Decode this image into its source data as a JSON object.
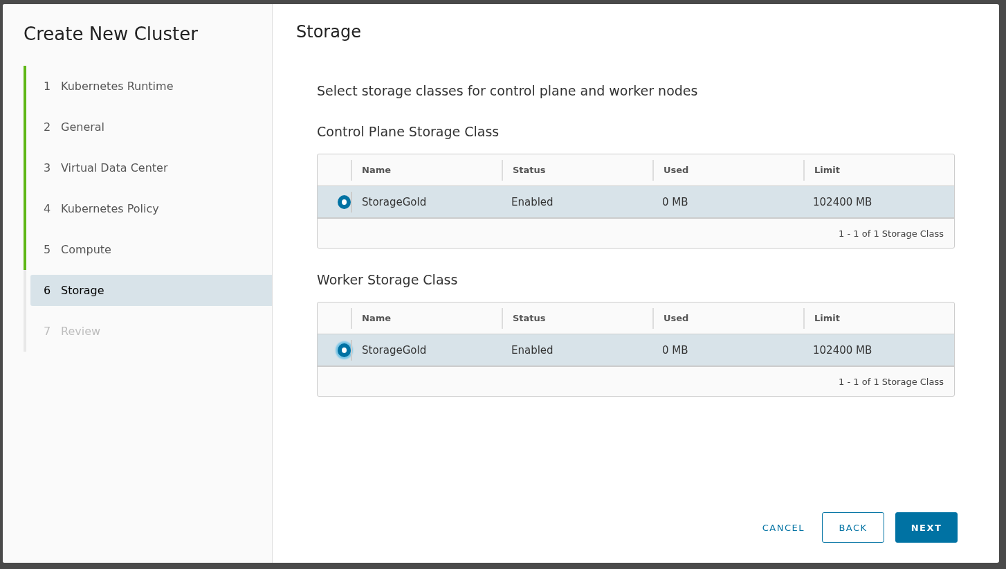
{
  "wizard": {
    "title": "Create New Cluster",
    "steps": [
      {
        "number": "1",
        "label": "Kubernetes Runtime",
        "completed": true,
        "selected": false,
        "disabled": false
      },
      {
        "number": "2",
        "label": "General",
        "completed": true,
        "selected": false,
        "disabled": false
      },
      {
        "number": "3",
        "label": "Virtual Data Center",
        "completed": true,
        "selected": false,
        "disabled": false
      },
      {
        "number": "4",
        "label": "Kubernetes Policy",
        "completed": true,
        "selected": false,
        "disabled": false
      },
      {
        "number": "5",
        "label": "Compute",
        "completed": true,
        "selected": false,
        "disabled": false
      },
      {
        "number": "6",
        "label": "Storage",
        "completed": false,
        "selected": true,
        "disabled": false
      },
      {
        "number": "7",
        "label": "Review",
        "completed": false,
        "selected": false,
        "disabled": true
      }
    ]
  },
  "page": {
    "title": "Storage",
    "description": "Select storage classes for control plane and worker nodes",
    "sections": [
      {
        "heading": "Control Plane Storage Class",
        "table": {
          "columns": [
            "Name",
            "Status",
            "Used",
            "Limit"
          ],
          "rows": [
            {
              "selected": true,
              "focused": false,
              "cells": [
                "StorageGold",
                "Enabled",
                "0 MB",
                "102400 MB"
              ]
            }
          ],
          "footer": "1 - 1 of 1 Storage Class"
        }
      },
      {
        "heading": "Worker Storage Class",
        "table": {
          "columns": [
            "Name",
            "Status",
            "Used",
            "Limit"
          ],
          "rows": [
            {
              "selected": true,
              "focused": true,
              "cells": [
                "StorageGold",
                "Enabled",
                "0 MB",
                "102400 MB"
              ]
            }
          ],
          "footer": "1 - 1 of 1 Storage Class"
        }
      }
    ]
  },
  "buttons": [
    {
      "kind": "flat",
      "label": "CANCEL"
    },
    {
      "kind": "outline",
      "label": "BACK"
    },
    {
      "kind": "primary",
      "label": "NEXT"
    }
  ]
}
